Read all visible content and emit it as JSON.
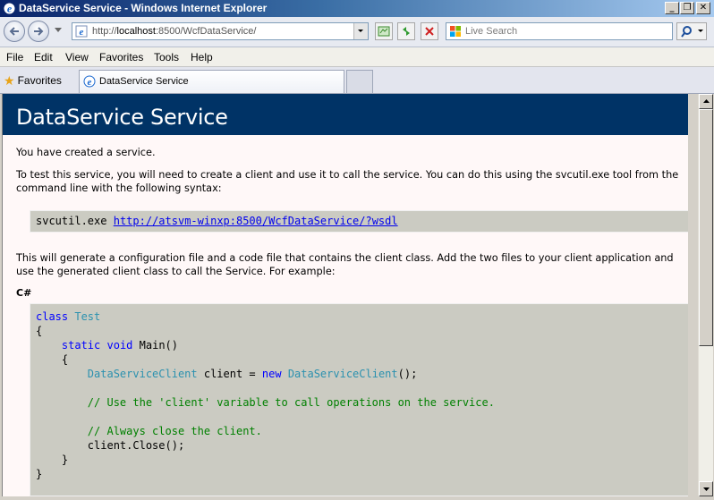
{
  "window": {
    "title": "DataService Service - Windows Internet Explorer",
    "minimize": "_",
    "maximize": "❐",
    "close": "✕"
  },
  "address": {
    "url_prefix": "http://",
    "url_host": "localhost",
    "url_rest": ":8500/WcfDataService/"
  },
  "search": {
    "placeholder": "Live Search"
  },
  "menu": [
    "File",
    "Edit",
    "View",
    "Favorites",
    "Tools",
    "Help"
  ],
  "tabs": {
    "favorites": "Favorites",
    "active_tab": "DataService Service"
  },
  "page": {
    "heading": "DataService Service",
    "intro": "You have created a service.",
    "test_line1": "To test this service, you will need to create a client and use it to call the service. You can do this using the svcutil.exe tool from the",
    "test_line2": "command line with the following syntax:",
    "cmd": "svcutil.exe",
    "wsdl_link": "http://atsvm-winxp:8500/WcfDataService/?wsdl",
    "gen_line1": "This will generate a configuration file and a code file that contains the client class. Add the two files to your client application and",
    "gen_line2": "use the generated client class to call the Service. For example:",
    "lang": "C#"
  },
  "code": {
    "l1_kw": "class",
    "l1_ty": "Test",
    "l2": "{",
    "l3_kw1": "static",
    "l3_kw2": "void",
    "l3_rest": "Main()",
    "l4": "{",
    "l5_ty1": "DataServiceClient",
    "l5_mid": "client =",
    "l5_kw": "new",
    "l5_ty2": "DataServiceClient",
    "l5_end": "();",
    "l7": "// Use the 'client' variable to call operations on the service.",
    "l9": "// Always close the client.",
    "l10": "client.Close();",
    "l11": "}",
    "l12": "}"
  },
  "colors": {
    "heading_bg": "#003366",
    "page_bg": "#fff8f8",
    "code_bg": "#cbcbc2",
    "keyword": "#0000ff",
    "type": "#2b91af",
    "comment": "#008000",
    "link": "#0000ee"
  }
}
